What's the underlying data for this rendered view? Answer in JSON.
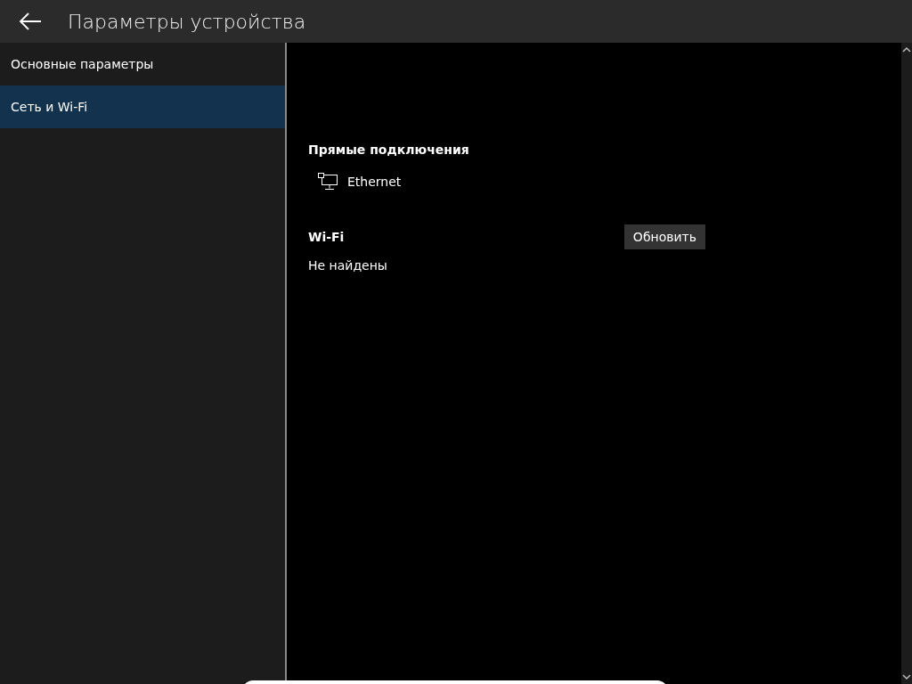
{
  "header": {
    "title": "Параметры устройства"
  },
  "sidebar": {
    "items": [
      {
        "label": "Основные параметры",
        "selected": false
      },
      {
        "label": "Сеть и Wi-Fi",
        "selected": true
      }
    ]
  },
  "direct_connections": {
    "heading": "Прямые подключения",
    "items": [
      {
        "label": "Ethernet"
      }
    ]
  },
  "wifi": {
    "heading": "Wi-Fi",
    "refresh_button": "Обновить",
    "status": "Не найдены"
  }
}
